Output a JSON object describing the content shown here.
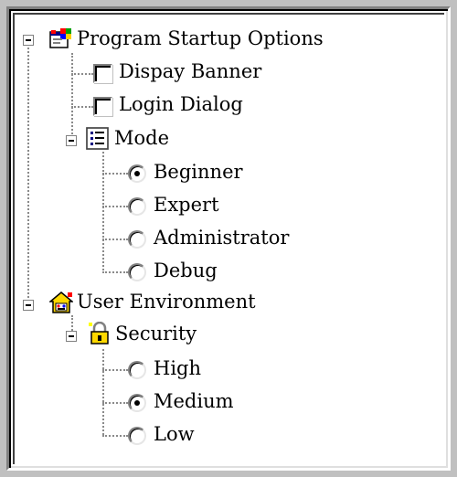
{
  "tree": {
    "program_startup": {
      "label": "Program Startup Options",
      "icon": "program-window-icon",
      "expanded": true,
      "items": {
        "display_banner": {
          "label": "Dispay Banner",
          "checked": false
        },
        "login_dialog": {
          "label": "Login Dialog",
          "checked": false
        }
      },
      "mode": {
        "label": "Mode",
        "icon": "list-icon",
        "expanded": true,
        "options": {
          "beginner": {
            "label": "Beginner",
            "selected": true
          },
          "expert": {
            "label": "Expert",
            "selected": false
          },
          "administrator": {
            "label": "Administrator",
            "selected": false
          },
          "debug": {
            "label": "Debug",
            "selected": false
          }
        }
      }
    },
    "user_environment": {
      "label": "User Environment",
      "icon": "user-environment-icon",
      "expanded": true,
      "security": {
        "label": "Security",
        "icon": "lock-icon",
        "expanded": true,
        "options": {
          "high": {
            "label": "High",
            "selected": false
          },
          "medium": {
            "label": "Medium",
            "selected": true
          },
          "low": {
            "label": "Low",
            "selected": false
          }
        }
      }
    }
  }
}
